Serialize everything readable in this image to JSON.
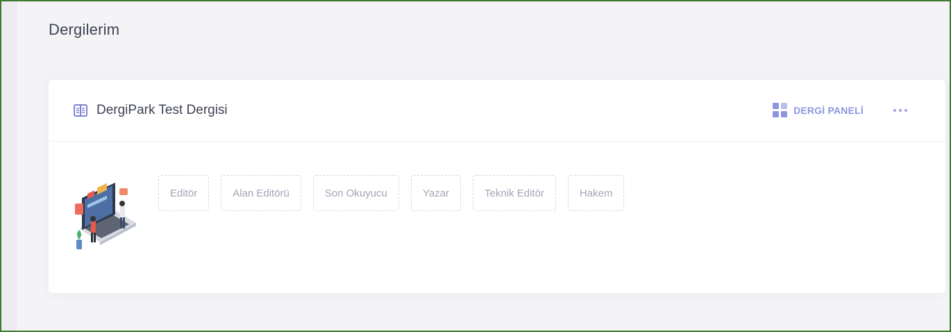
{
  "page": {
    "title": "Dergilerim"
  },
  "journal": {
    "name": "DergiPark Test Dergisi",
    "icon": "book-icon",
    "panel_label": "DERGİ PANELİ",
    "panel_icon": "grid-icon",
    "more_icon": "more-dots-icon",
    "accent_color": "#8c96e0",
    "roles": [
      "Editör",
      "Alan Editörü",
      "Son Okuyucu",
      "Yazar",
      "Teknik Editör",
      "Hakem"
    ]
  }
}
